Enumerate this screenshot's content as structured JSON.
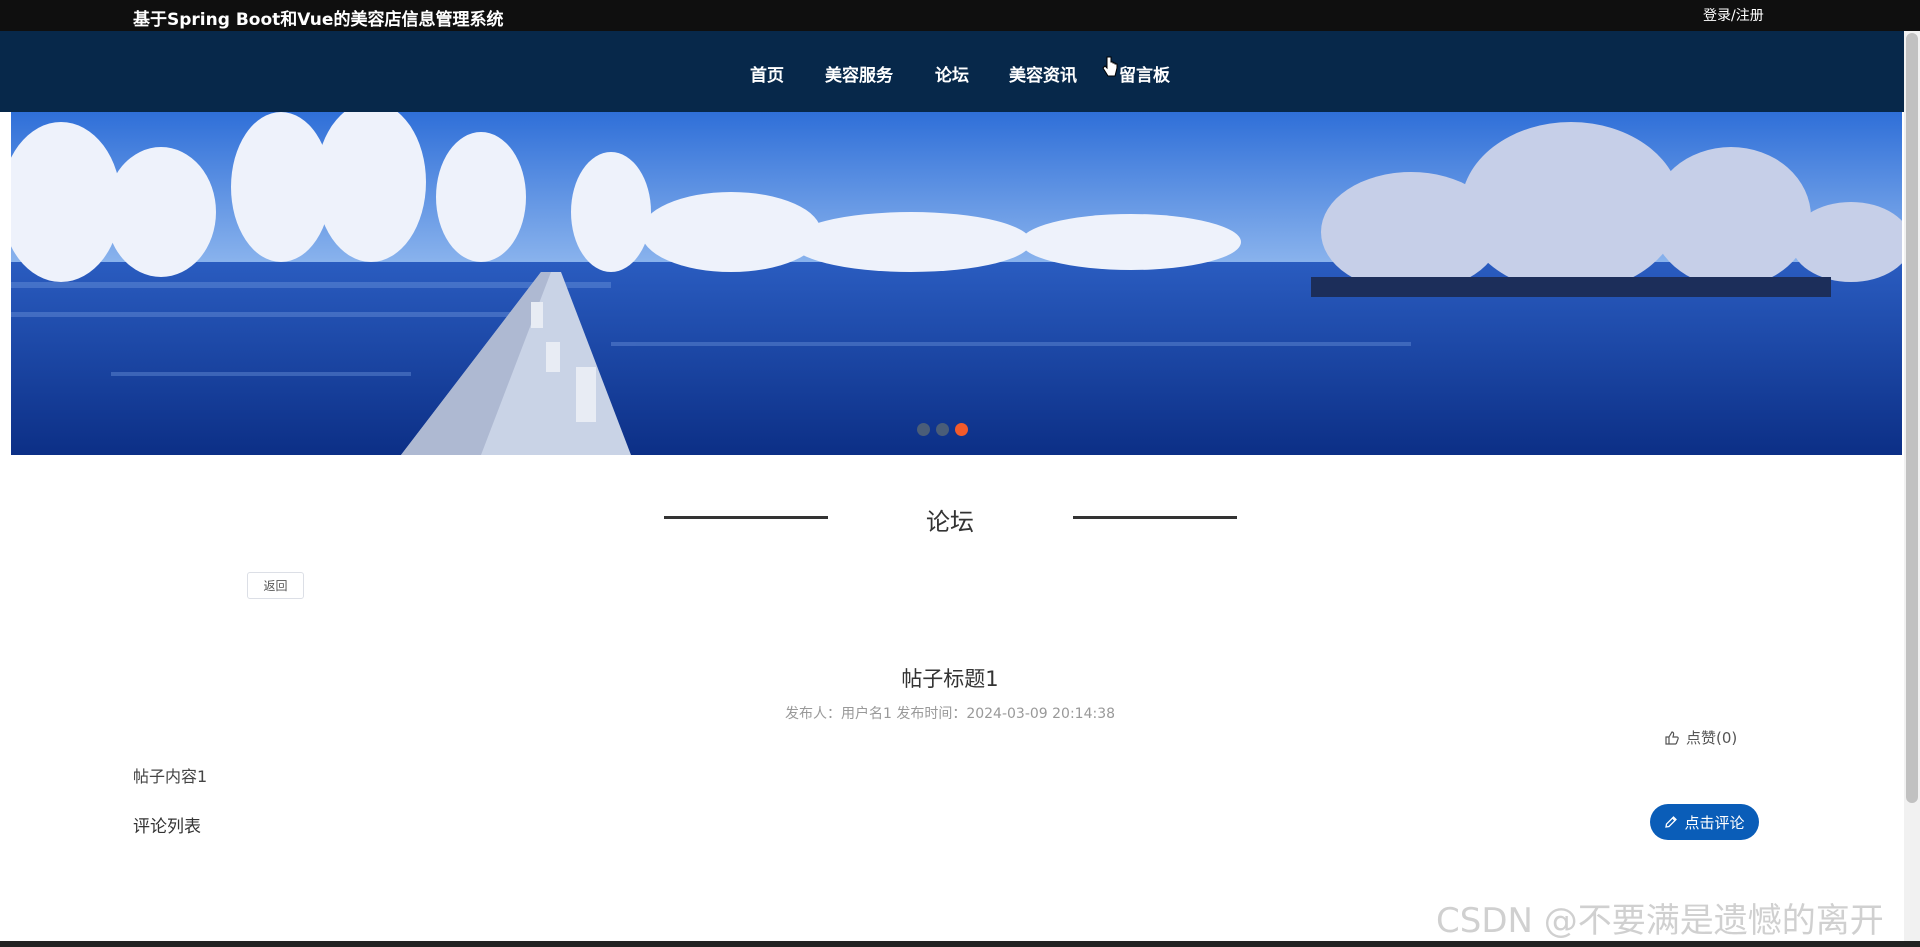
{
  "header": {
    "site_title": "基于Spring Boot和Vue的美容店信息管理系统",
    "login_label": "登录/注册"
  },
  "nav": {
    "items": [
      "首页",
      "美容服务",
      "论坛",
      "美容资讯",
      "留言板"
    ]
  },
  "banner": {
    "slide_count": 3,
    "active_index": 2
  },
  "section": {
    "title": "论坛"
  },
  "post": {
    "back_label": "返回",
    "title": "帖子标题1",
    "meta": "发布人：用户名1  发布时间：2024-03-09 20:14:38",
    "like_label": "点赞(0)",
    "content": "帖子内容1",
    "comments_label": "评论列表",
    "comment_button": "点击评论"
  },
  "watermark": "CSDN @不要满是遗憾的离开",
  "colors": {
    "topbar": "#0f0f0f",
    "navbar": "#07284a",
    "accent": "#0a5db8",
    "active_dot": "#f25a2a"
  }
}
